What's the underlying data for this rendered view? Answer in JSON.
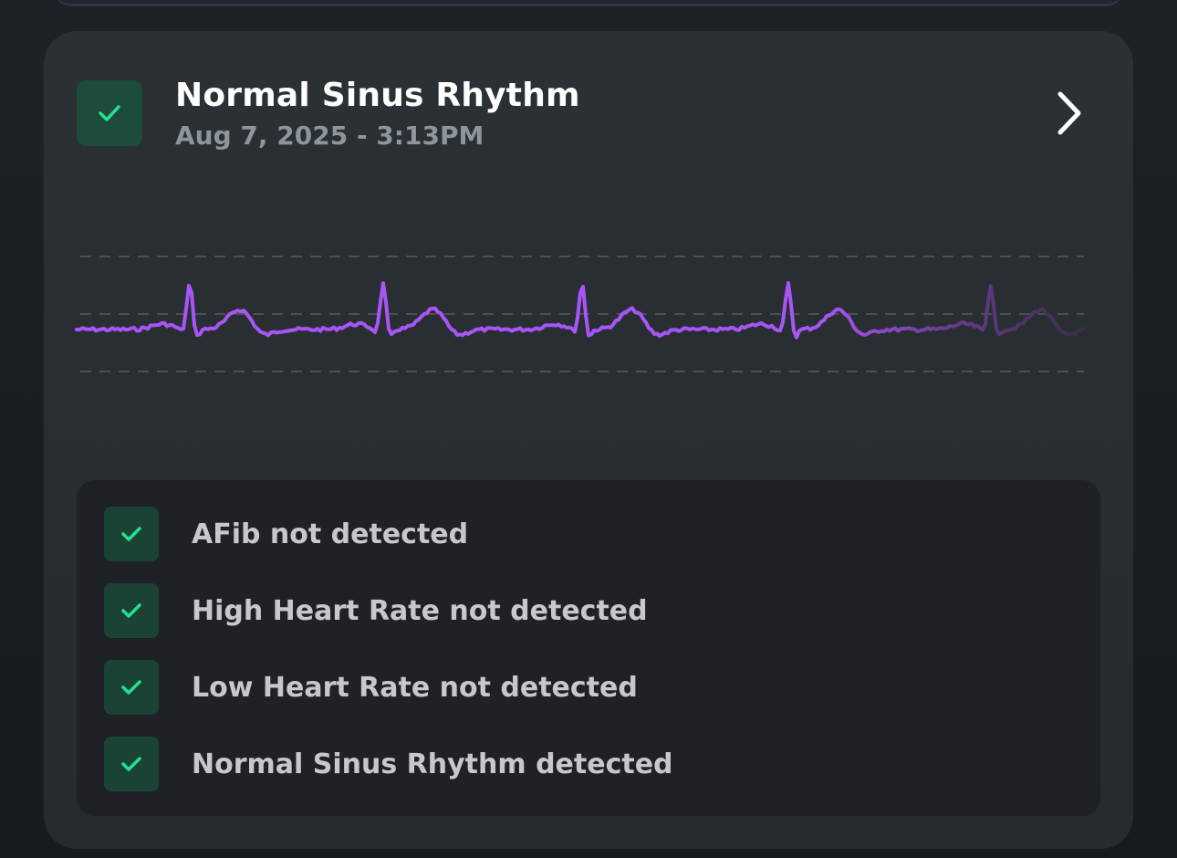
{
  "reading": {
    "title": "Normal Sinus Rhythm",
    "timestamp": "Aug 7, 2025 - 3:13PM",
    "status_icon": "checkmark-icon",
    "open_icon": "chevron-right-icon"
  },
  "ecg": {
    "trace_color": "#a855f7",
    "fade_color": "#4b3462",
    "grid_color": "#4a5055"
  },
  "results": [
    {
      "label": "AFib not detected",
      "icon": "checkmark-icon"
    },
    {
      "label": "High Heart Rate not detected",
      "icon": "checkmark-icon"
    },
    {
      "label": "Low Heart Rate not detected",
      "icon": "checkmark-icon"
    },
    {
      "label": "Normal Sinus Rhythm detected",
      "icon": "checkmark-icon"
    }
  ],
  "colors": {
    "accent_green": "#25e08f",
    "check_bg": "#1a4336"
  }
}
